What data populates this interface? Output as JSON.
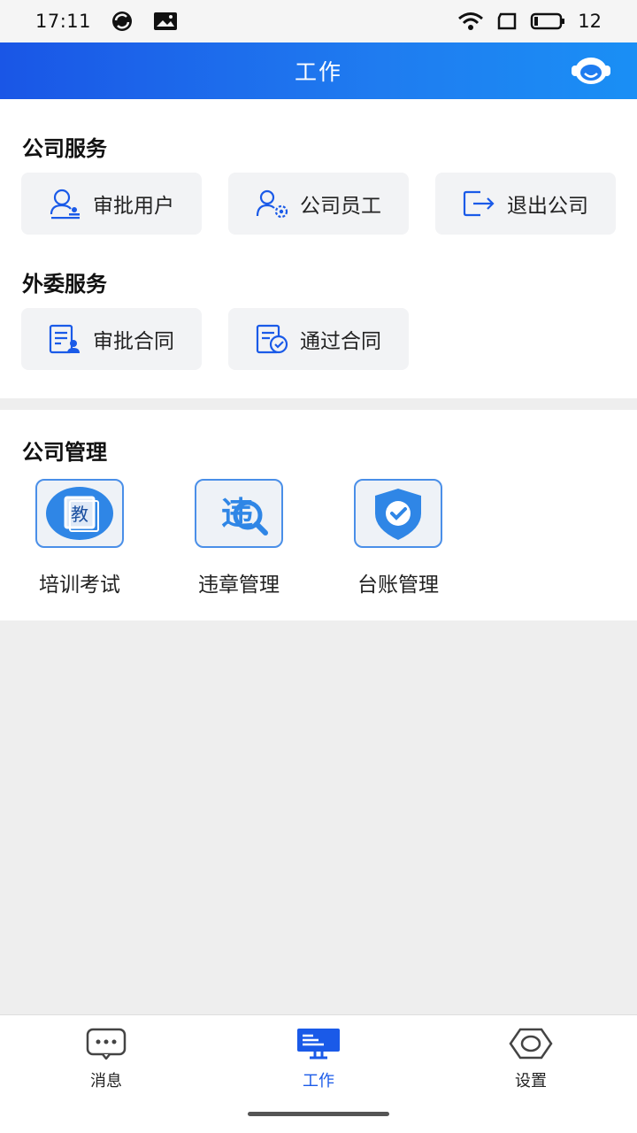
{
  "status_bar": {
    "time": "17:11",
    "battery": "12"
  },
  "header": {
    "title": "工作",
    "service_icon": "customer-service-icon"
  },
  "company_services": {
    "title": "公司服务",
    "items": [
      {
        "label": "审批用户",
        "icon": "approve-user-icon"
      },
      {
        "label": "公司员工",
        "icon": "employee-settings-icon"
      },
      {
        "label": "退出公司",
        "icon": "exit-company-icon"
      }
    ]
  },
  "outsourced_services": {
    "title": "外委服务",
    "items": [
      {
        "label": "审批合同",
        "icon": "approve-contract-icon"
      },
      {
        "label": "通过合同",
        "icon": "passed-contract-icon"
      }
    ]
  },
  "company_management": {
    "title": "公司管理",
    "items": [
      {
        "label": "培训考试",
        "icon": "training-exam-icon",
        "glyph": "教"
      },
      {
        "label": "违章管理",
        "icon": "violation-icon",
        "glyph": "违"
      },
      {
        "label": "台账管理",
        "icon": "ledger-shield-icon"
      }
    ]
  },
  "bottom_nav": {
    "items": [
      {
        "label": "消息",
        "icon": "message-icon",
        "active": false
      },
      {
        "label": "工作",
        "icon": "work-icon",
        "active": true
      },
      {
        "label": "设置",
        "icon": "settings-icon",
        "active": false
      }
    ]
  },
  "colors": {
    "primary": "#1a5ae8",
    "header_start": "#1a56e6",
    "header_end": "#1a8ff5",
    "chip_bg": "#f2f3f5",
    "page_bg": "#eeeeee"
  }
}
